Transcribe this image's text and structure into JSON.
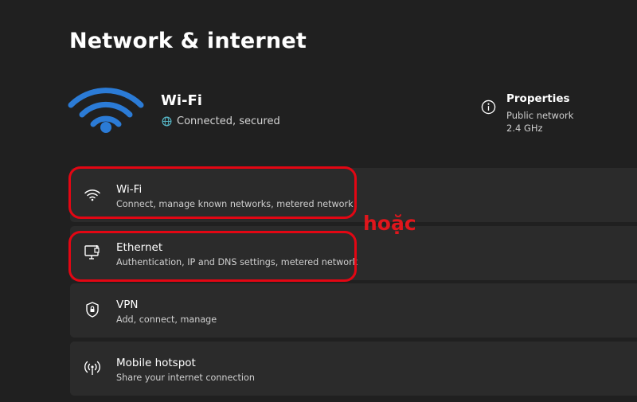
{
  "page": {
    "title": "Network & internet"
  },
  "status": {
    "network_name": "Wi-Fi",
    "connection_text": "Connected, secured",
    "properties_label": "Properties",
    "network_type": "Public network",
    "band": "2.4 GHz"
  },
  "settings": [
    {
      "icon": "wifi-icon",
      "title": "Wi-Fi",
      "subtitle": "Connect, manage known networks, metered network"
    },
    {
      "icon": "ethernet-icon",
      "title": "Ethernet",
      "subtitle": "Authentication, IP and DNS settings, metered network"
    },
    {
      "icon": "vpn-shield-icon",
      "title": "VPN",
      "subtitle": "Add, connect, manage"
    },
    {
      "icon": "hotspot-icon",
      "title": "Mobile hotspot",
      "subtitle": "Share your internet connection"
    }
  ],
  "annotation": {
    "text": "hoặc",
    "color": "#e30613"
  },
  "colors": {
    "accent": "#2b7bd6",
    "card": "#2b2b2b",
    "background": "#202020"
  }
}
